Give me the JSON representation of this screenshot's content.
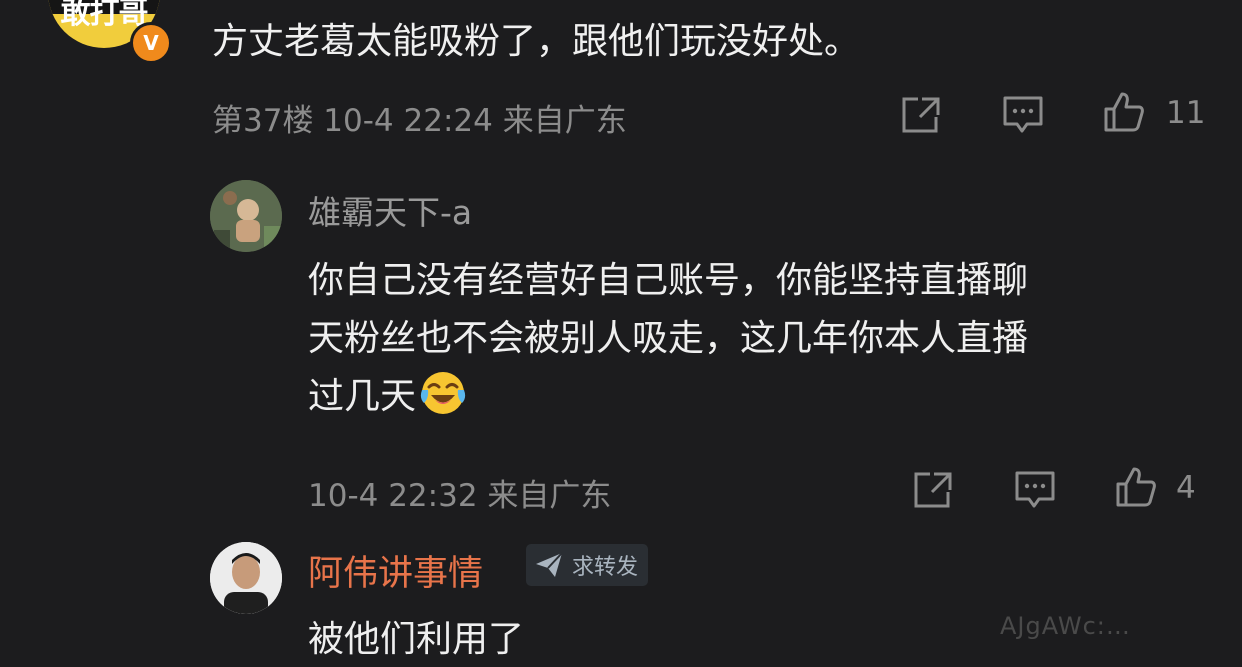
{
  "root_comment": {
    "avatar_text": "敢打哥",
    "verified_badge": "V",
    "text": "方丈老葛太能吸粉了，跟他们玩没好处。",
    "meta": "第37楼 10-4 22:24 来自广东",
    "like_count": "11"
  },
  "replies": [
    {
      "username": "雄霸天下-a",
      "body_lines": [
        "你自己没有经营好自己账号，你能坚持直播聊",
        "天粉丝也不会被别人吸走，这几年你本人直播",
        "过几天"
      ],
      "emoji": "laughing-crying",
      "meta": "10-4 22:32 来自广东",
      "like_count": "4"
    },
    {
      "username": "阿伟讲事情",
      "tag_label": "求转发",
      "body": "被他们利用了"
    }
  ],
  "watermark": "AJgAWc:…"
}
